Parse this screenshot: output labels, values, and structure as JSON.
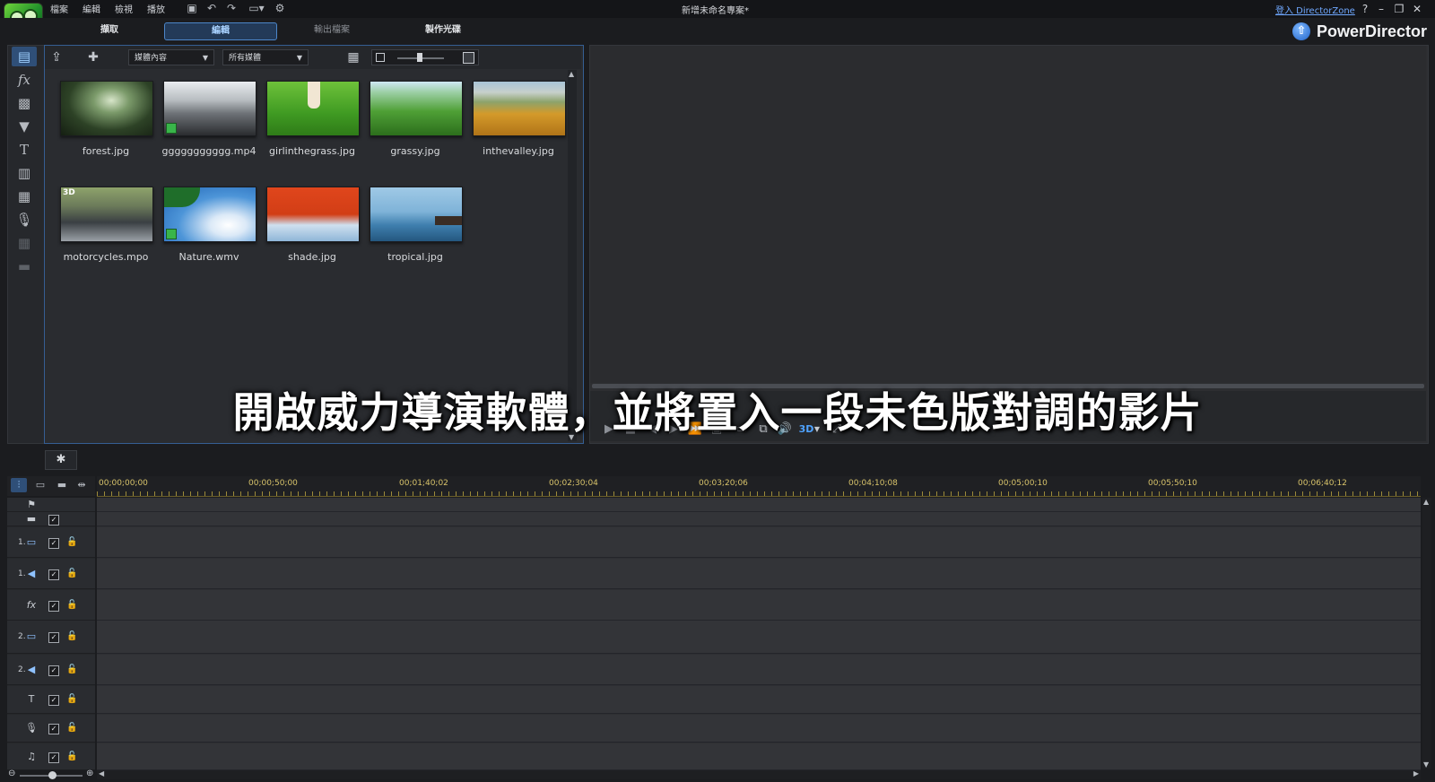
{
  "window": {
    "project_title": "新增未命名專案*",
    "login_link": "登入 DirectorZone",
    "help": "?",
    "minimize": "–",
    "restore": "❐",
    "close": "✕"
  },
  "menu": [
    "檔案",
    "編輯",
    "檢視",
    "播放"
  ],
  "modes": [
    "擷取",
    "編輯",
    "輸出檔案",
    "製作光碟"
  ],
  "brand": {
    "name": "PowerDirector"
  },
  "library": {
    "filter_content": "媒體內容",
    "filter_type": "所有媒體",
    "items": [
      {
        "name": "forest.jpg"
      },
      {
        "name": "ggggggggggg.mp4"
      },
      {
        "name": "girlinthegrass.jpg"
      },
      {
        "name": "grassy.jpg"
      },
      {
        "name": "inthevalley.jpg"
      },
      {
        "name": "motorcycles.mpo",
        "badge": "3D"
      },
      {
        "name": "Nature.wmv"
      },
      {
        "name": "shade.jpg"
      },
      {
        "name": "tropical.jpg"
      }
    ]
  },
  "player": {
    "mode_3d": "3D"
  },
  "subtitle": "開啟威力導演軟體，並將置入一段未色版對調的影片",
  "timeline": {
    "ruler": [
      "00;00;00;00",
      "00;00;50;00",
      "00;01;40;02",
      "00;02;30;04",
      "00;03;20;06",
      "00;04;10;08",
      "00;05;00;10",
      "00;05;50;10",
      "00;06;40;12"
    ],
    "tracks": [
      {
        "num": "",
        "icon": "chapter-flag-icon",
        "glyph": "⚑"
      },
      {
        "num": "",
        "icon": "subtitle-icon",
        "glyph": "▬"
      },
      {
        "num": "1.",
        "icon": "video-track-icon",
        "glyph": "▭"
      },
      {
        "num": "1.",
        "icon": "audio-track-icon",
        "glyph": "◀"
      },
      {
        "num": "",
        "icon": "fx-track-icon",
        "glyph": "fx"
      },
      {
        "num": "2.",
        "icon": "video-track-icon",
        "glyph": "▭"
      },
      {
        "num": "2.",
        "icon": "audio-track-icon",
        "glyph": "◀"
      },
      {
        "num": "",
        "icon": "title-track-icon",
        "glyph": "T"
      },
      {
        "num": "",
        "icon": "voice-track-icon",
        "glyph": "🎙"
      },
      {
        "num": "",
        "icon": "music-track-icon",
        "glyph": "♫"
      }
    ]
  }
}
